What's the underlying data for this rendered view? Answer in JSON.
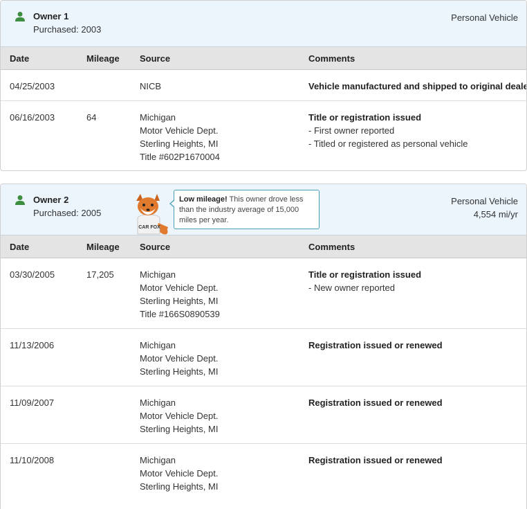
{
  "owners": [
    {
      "name": "Owner 1",
      "purchased": "Purchased: 2003",
      "vehicle_type": "Personal Vehicle",
      "columns": {
        "date": "Date",
        "mileage": "Mileage",
        "source": "Source",
        "comments": "Comments"
      },
      "records": [
        {
          "date": "04/25/2003",
          "mileage": "",
          "source": [
            "NICB"
          ],
          "comment_title": "Vehicle manufactured and shipped to original dealer",
          "comment_items": []
        },
        {
          "date": "06/16/2003",
          "mileage": "64",
          "source": [
            "Michigan",
            "Motor Vehicle Dept.",
            "Sterling Heights, MI",
            "Title #602P1670004"
          ],
          "comment_title": "Title or registration issued",
          "comment_items": [
            "- First owner reported",
            "- Titled or registered as personal vehicle"
          ]
        }
      ]
    },
    {
      "name": "Owner 2",
      "purchased": "Purchased: 2005",
      "vehicle_type": "Personal Vehicle",
      "mileage_rate": "4,554 mi/yr",
      "tip": {
        "bold": "Low mileage!",
        "text": " This owner drove less than the industry average of 15,000 miles per year."
      },
      "mascot_badge": "CAR FOX",
      "columns": {
        "date": "Date",
        "mileage": "Mileage",
        "source": "Source",
        "comments": "Comments"
      },
      "records": [
        {
          "date": "03/30/2005",
          "mileage": "17,205",
          "source": [
            "Michigan",
            "Motor Vehicle Dept.",
            "Sterling Heights, MI",
            "Title #166S0890539"
          ],
          "comment_title": "Title or registration issued",
          "comment_items": [
            "- New owner reported"
          ]
        },
        {
          "date": "11/13/2006",
          "mileage": "",
          "source": [
            "Michigan",
            "Motor Vehicle Dept.",
            "Sterling Heights, MI"
          ],
          "comment_title": "Registration issued or renewed",
          "comment_items": []
        },
        {
          "date": "11/09/2007",
          "mileage": "",
          "source": [
            "Michigan",
            "Motor Vehicle Dept.",
            "Sterling Heights, MI"
          ],
          "comment_title": "Registration issued or renewed",
          "comment_items": []
        },
        {
          "date": "11/10/2008",
          "mileage": "",
          "source": [
            "Michigan",
            "Motor Vehicle Dept.",
            "Sterling Heights, MI"
          ],
          "comment_title": "Registration issued or renewed",
          "comment_items": []
        }
      ]
    }
  ],
  "colors": {
    "header_bg": "#edf5fc",
    "table_head_bg": "#e4e4e4",
    "person_icon": "#3e8e41",
    "bubble_border": "#4a9fb8",
    "fox_orange": "#e07a2e"
  },
  "icons": {
    "owner": "person-icon",
    "mascot": "carfox-mascot-icon"
  }
}
